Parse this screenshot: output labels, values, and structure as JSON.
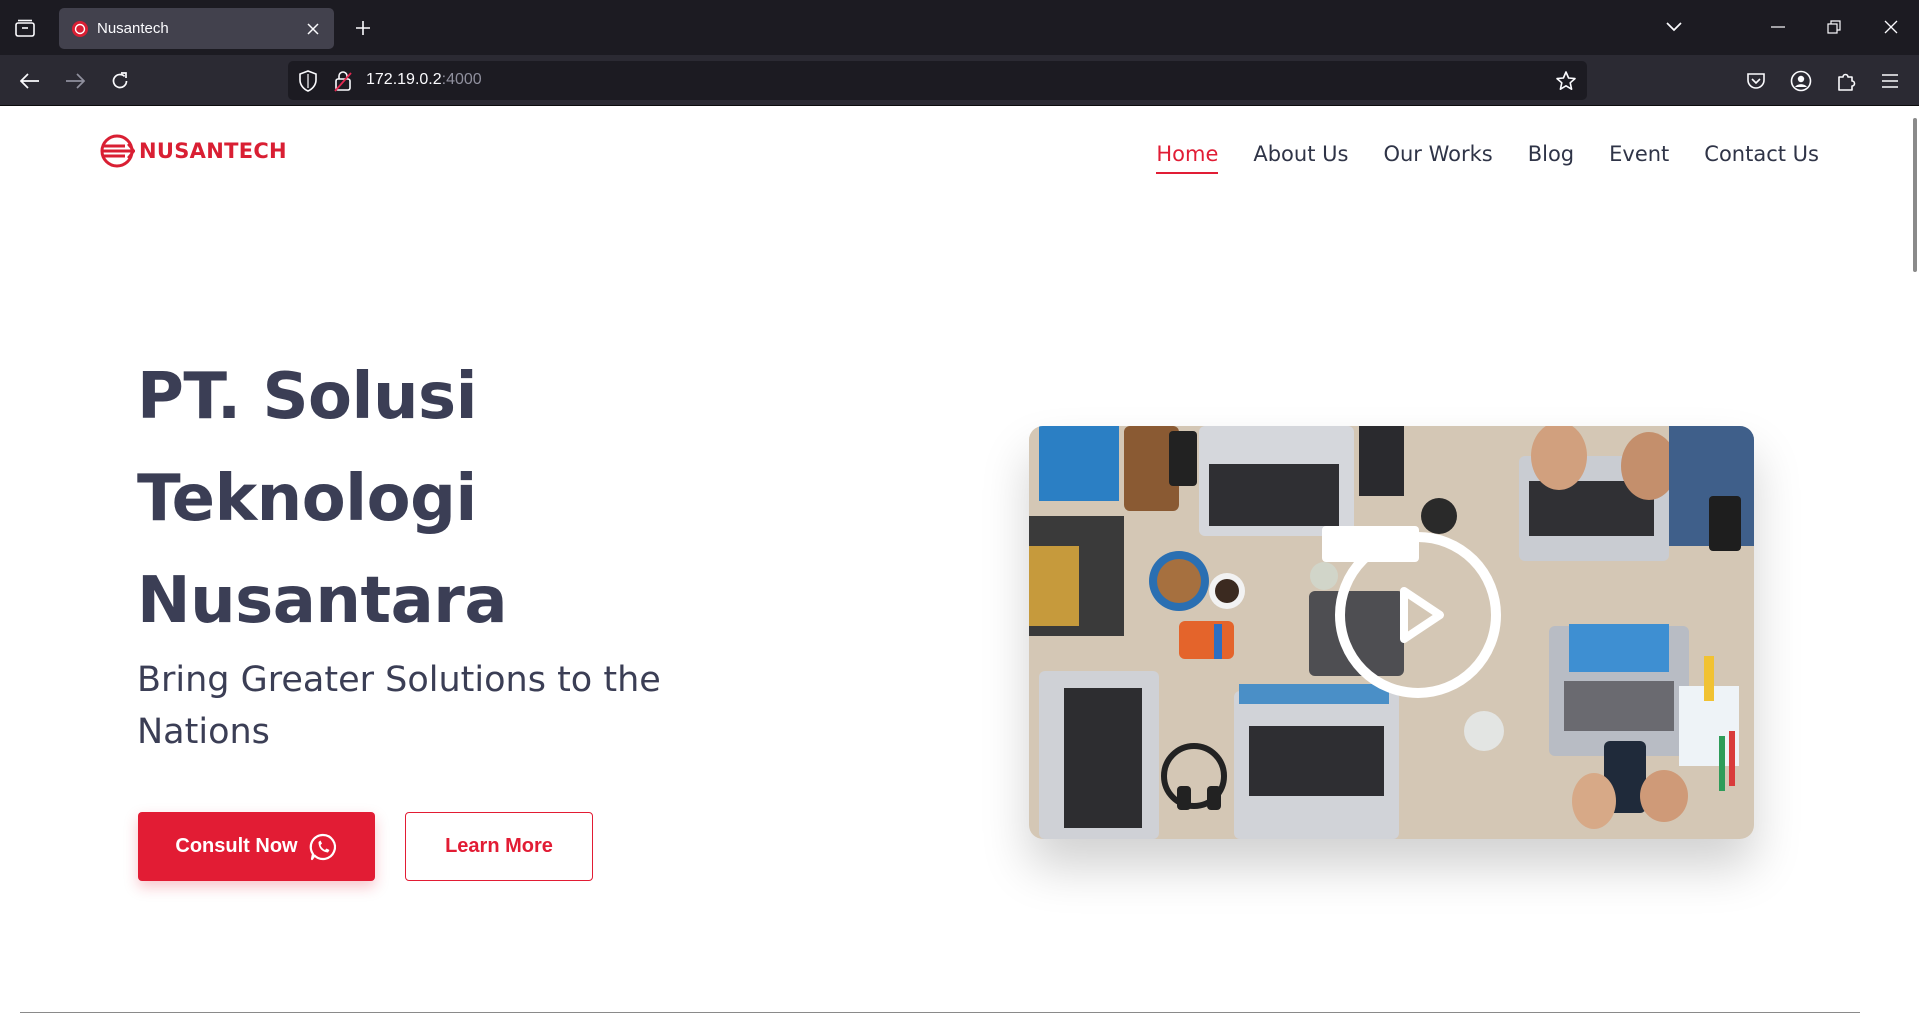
{
  "browser": {
    "tab": {
      "title": "Nusantech"
    },
    "url": {
      "host": "172.19.0.2",
      "port": ":4000"
    }
  },
  "site": {
    "logo_text": "NUSANTECH",
    "nav": [
      {
        "label": "Home",
        "active": true
      },
      {
        "label": "About Us",
        "active": false
      },
      {
        "label": "Our Works",
        "active": false
      },
      {
        "label": "Blog",
        "active": false
      },
      {
        "label": "Event",
        "active": false
      },
      {
        "label": "Contact Us",
        "active": false
      }
    ]
  },
  "hero": {
    "title_lines": [
      "PT. Solusi",
      "Teknologi",
      "Nusantara"
    ],
    "subtitle_lines": [
      "Bring Greater Solutions to the",
      "Nations"
    ],
    "consult_label": "Consult Now",
    "learn_label": "Learn More"
  },
  "colors": {
    "brand": "#e21c34",
    "heading": "#3b3e55",
    "chrome_dark": "#1c1b22",
    "chrome_toolbar": "#2b2a33"
  }
}
